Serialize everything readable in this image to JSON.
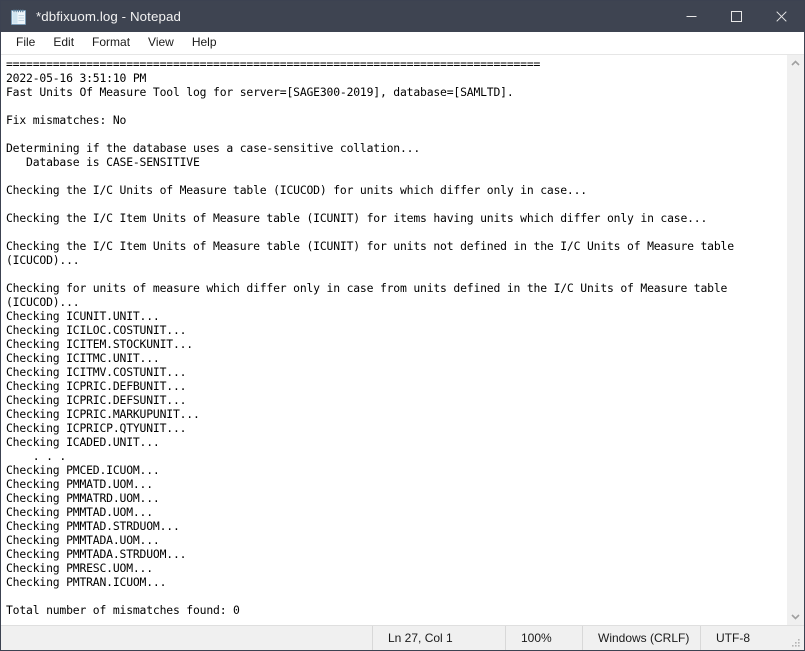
{
  "window": {
    "title": "*dbfixuom.log - Notepad",
    "icon": "notepad-icon",
    "titlebar_color": "#3e4451",
    "controls": {
      "minimize": "minimize-icon",
      "maximize": "maximize-icon",
      "close": "close-icon"
    }
  },
  "menubar": {
    "items": [
      {
        "label": "File"
      },
      {
        "label": "Edit"
      },
      {
        "label": "Format"
      },
      {
        "label": "View"
      },
      {
        "label": "Help"
      }
    ]
  },
  "editor": {
    "content": "================================================================================\n2022-05-16 3:51:10 PM\nFast Units Of Measure Tool log for server=[SAGE300-2019], database=[SAMLTD].\n\nFix mismatches: No\n\nDetermining if the database uses a case-sensitive collation...\n   Database is CASE-SENSITIVE\n\nChecking the I/C Units of Measure table (ICUCOD) for units which differ only in case...\n\nChecking the I/C Item Units of Measure table (ICUNIT) for items having units which differ only in case...\n\nChecking the I/C Item Units of Measure table (ICUNIT) for units not defined in the I/C Units of Measure table\n(ICUCOD)...\n\nChecking for units of measure which differ only in case from units defined in the I/C Units of Measure table\n(ICUCOD)...\nChecking ICUNIT.UNIT...\nChecking ICILOC.COSTUNIT...\nChecking ICITEM.STOCKUNIT...\nChecking ICITMC.UNIT...\nChecking ICITMV.COSTUNIT...\nChecking ICPRIC.DEFBUNIT...\nChecking ICPRIC.DEFSUNIT...\nChecking ICPRIC.MARKUPUNIT...\nChecking ICPRICP.QTYUNIT...\nChecking ICADED.UNIT...\n    . . .\nChecking PMCED.ICUOM...\nChecking PMMATD.UOM...\nChecking PMMATRD.UOM...\nChecking PMMTAD.UOM...\nChecking PMMTAD.STRDUOM...\nChecking PMMTADA.UOM...\nChecking PMMTADA.STRDUOM...\nChecking PMRESC.UOM...\nChecking PMTRAN.ICUOM...\n\nTotal number of mismatches found: 0"
  },
  "scrollbar": {
    "up_arrow": "chevron-up-icon",
    "down_arrow": "chevron-down-icon"
  },
  "statusbar": {
    "cursor_position": "Ln 27, Col 1",
    "zoom": "100%",
    "line_ending": "Windows (CRLF)",
    "encoding": "UTF-8"
  }
}
